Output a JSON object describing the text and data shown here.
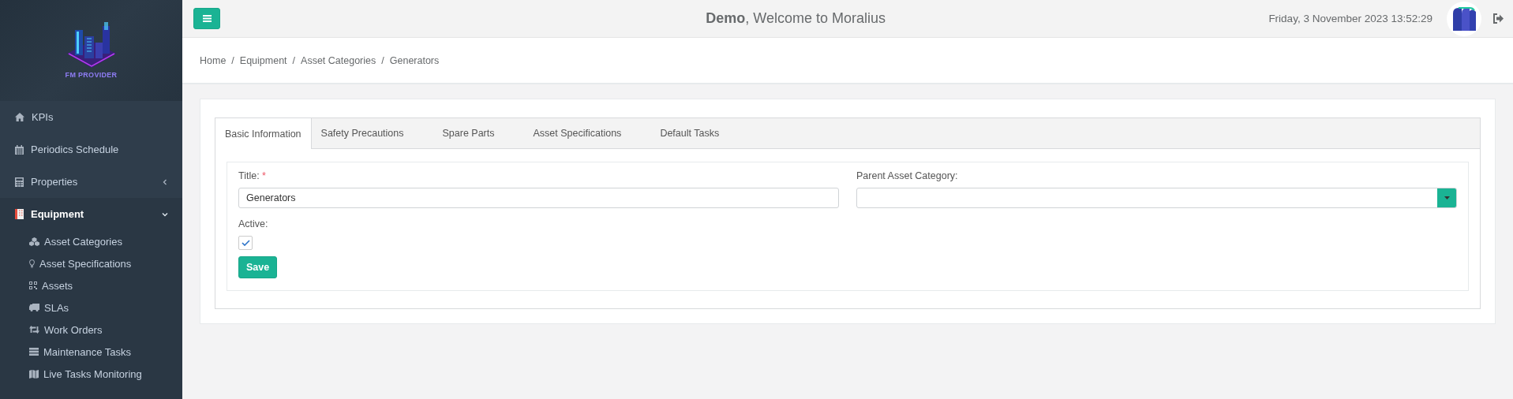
{
  "sidebar": {
    "logo_text": "FM PROVIDER",
    "items": [
      {
        "label": "KPIs",
        "selected": false
      },
      {
        "label": "Periodics Schedule",
        "selected": false
      },
      {
        "label": "Properties",
        "selected": false,
        "expanded": false
      },
      {
        "label": "Equipment",
        "selected": true,
        "expanded": true,
        "children": [
          {
            "label": "Asset Categories",
            "selected": false
          },
          {
            "label": "Asset Specifications",
            "selected": false
          },
          {
            "label": "Assets",
            "selected": false
          },
          {
            "label": "SLAs",
            "selected": false
          },
          {
            "label": "Work Orders",
            "selected": false
          },
          {
            "label": "Maintenance Tasks",
            "selected": false
          },
          {
            "label": "Live Tasks Monitoring",
            "selected": false
          }
        ]
      }
    ]
  },
  "header": {
    "welcome": "**Demo**, Welcome to Moralius",
    "datetime": "Friday, 3 November 2023 13:52:29"
  },
  "breadcrumb": {
    "separator": "/",
    "items": [
      "Home",
      "Equipment",
      "Asset Categories",
      "Generators"
    ]
  },
  "tabs": [
    {
      "label": "Basic Information",
      "selected": true
    },
    {
      "label": "Safety Precautions",
      "selected": false
    },
    {
      "label": "Spare Parts",
      "selected": false
    },
    {
      "label": "Asset Specifications",
      "selected": false
    },
    {
      "label": "Default Tasks",
      "selected": false
    }
  ],
  "form": {
    "title_field": {
      "label": "Title:",
      "required_mark": "*",
      "value": "Generators"
    },
    "parent_field": {
      "label": "Parent Asset Category:"
    },
    "active_field": {
      "label": "Active:",
      "checked": true
    },
    "save_button": "Save"
  }
}
